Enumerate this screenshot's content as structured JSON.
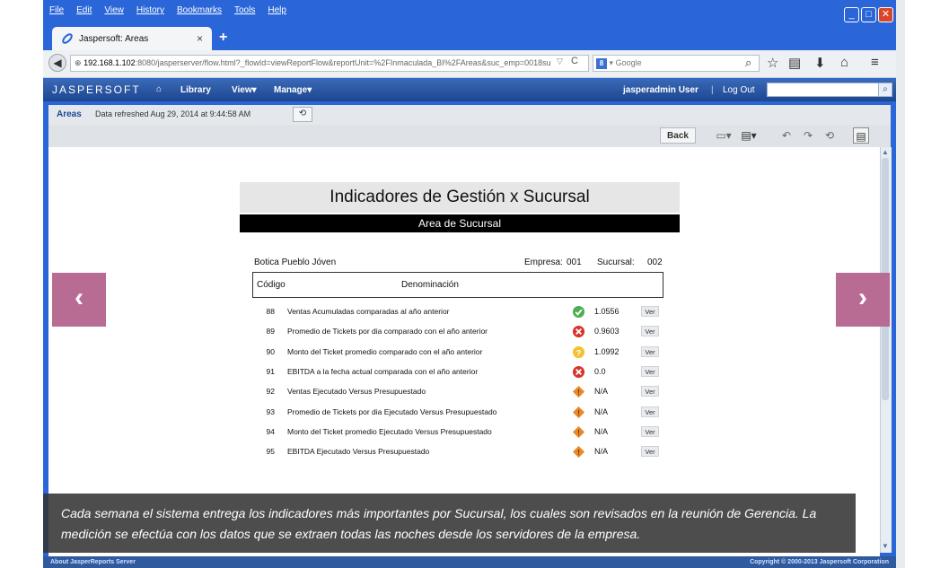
{
  "menu": [
    "File",
    "Edit",
    "View",
    "History",
    "Bookmarks",
    "Tools",
    "Help"
  ],
  "tab": {
    "title": "Jaspersoft: Areas",
    "close": "×",
    "new": "+"
  },
  "nav": {
    "url_host": "192.168.1.102",
    "url_rest": ":8080/jasperserver/flow.html?_flowId=viewReportFlow&reportUnit=%2FInmaculada_BI%2FAreas&suc_emp=0018su",
    "search_placeholder": "Google"
  },
  "jasper": {
    "logo": "JASPERSOFT",
    "library": "Library",
    "view": "View",
    "manage": "Manage",
    "user": "jasperadmin User",
    "logout": "Log Out"
  },
  "toolbar": {
    "areas": "Areas",
    "refreshed": "Data refreshed Aug 29, 2014 at 9:44:58 AM",
    "back": "Back"
  },
  "report": {
    "title": "Indicadores de Gestión x Sucursal",
    "subtitle": "Area de Sucursal",
    "branch": "Botica Pueblo Jóven",
    "empresa_label": "Empresa:",
    "empresa": "001",
    "sucursal_label": "Sucursal:",
    "sucursal": "002",
    "col_code": "Código",
    "col_name": "Denominación",
    "ver": "Ver",
    "rows": [
      {
        "code": "88",
        "desc": "Ventas Acumuladas comparadas al año anterior",
        "status": "ok",
        "value": "1.0556"
      },
      {
        "code": "89",
        "desc": "Promedio de Tickets por dia comparado con el año anterior",
        "status": "bad",
        "value": "0.9603"
      },
      {
        "code": "90",
        "desc": "Monto del Ticket promedio comparado con el año anterior",
        "status": "warn",
        "value": "1.0992"
      },
      {
        "code": "91",
        "desc": "EBITDA a la fecha actual comparada con el año anterior",
        "status": "bad",
        "value": "0.0"
      },
      {
        "code": "92",
        "desc": "Ventas Ejecutado Versus Presupuestado",
        "status": "na",
        "value": "N/A"
      },
      {
        "code": "93",
        "desc": "Promedio de Tickets por dia Ejecutado Versus Presupuestado",
        "status": "na",
        "value": "N/A"
      },
      {
        "code": "94",
        "desc": "Monto del Ticket promedio Ejecutado Versus Presupuestado",
        "status": "na",
        "value": "N/A"
      },
      {
        "code": "95",
        "desc": "EBITDA Ejecutado Versus Presupuestado",
        "status": "na",
        "value": "N/A"
      }
    ]
  },
  "footer": {
    "left": "About JasperReports Server",
    "right": "Copyright © 2000-2013 Jaspersoft Corporation"
  },
  "caption": "Cada semana el sistema entrega los indicadores más importantes por Sucursal, los cuales son revisados en la reunión de Gerencia. La medición se efectúa con los datos que se extraen todas las noches desde los servidores de la empresa.",
  "carousel": {
    "prev": "‹",
    "next": "›"
  },
  "colors": {
    "ok": "#4caf50",
    "bad": "#d9342b",
    "warn": "#f2c230",
    "na": "#e8892b",
    "accent": "#b86b93"
  }
}
